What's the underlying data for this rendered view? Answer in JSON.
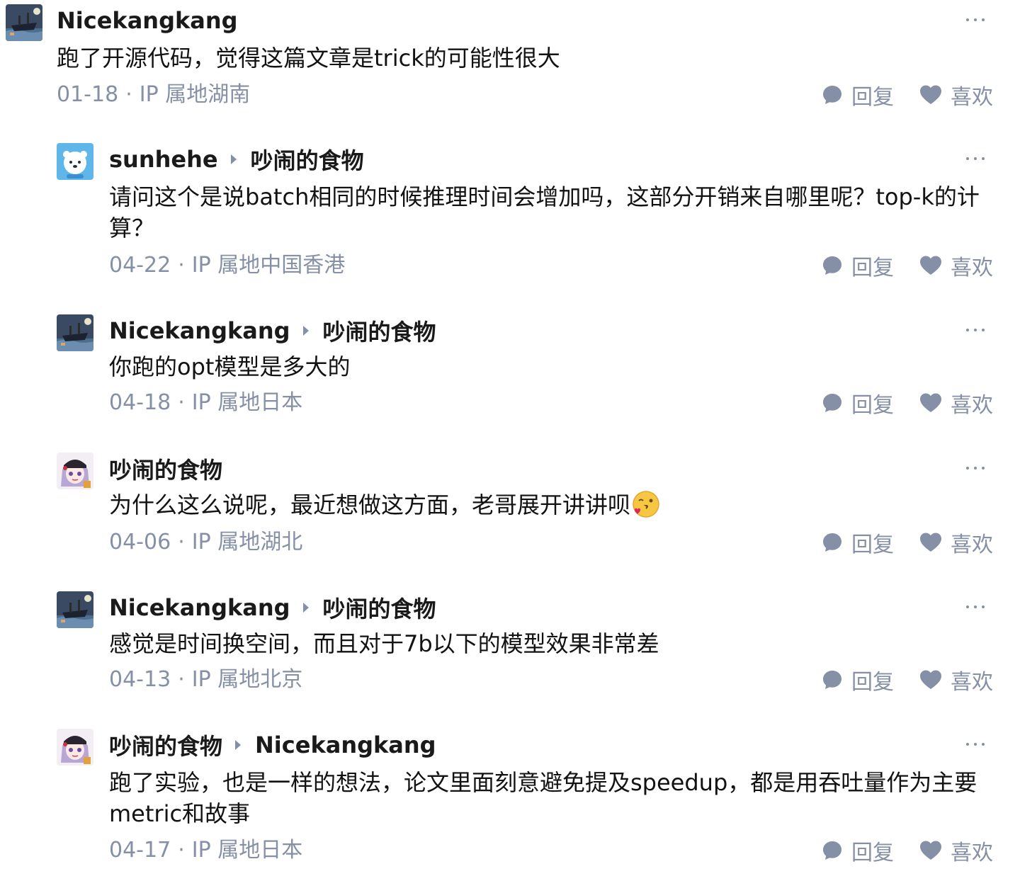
{
  "comments": [
    {
      "author": "Nicekangkang",
      "reply_to": "",
      "text": "跑了开源代码，觉得这篇文章是trick的可能性很大",
      "date": "01-18",
      "location": "IP 属地湖南"
    },
    {
      "author": "sunhehe",
      "reply_to": "吵闹的食物",
      "text": "请问这个是说batch相同的时候推理时间会增加吗，这部分开销来自哪里呢？top-k的计算？",
      "date": "04-22",
      "location": "IP 属地中国香港"
    },
    {
      "author": "Nicekangkang",
      "reply_to": "吵闹的食物",
      "text": "你跑的opt模型是多大的",
      "date": "04-18",
      "location": "IP 属地日本"
    },
    {
      "author": "吵闹的食物",
      "reply_to": "",
      "text": "为什么这么说呢，最近想做这方面，老哥展开讲讲呗",
      "date": "04-06",
      "location": "IP 属地湖北"
    },
    {
      "author": "Nicekangkang",
      "reply_to": "吵闹的食物",
      "text": "感觉是时间换空间，而且对于7b以下的模型效果非常差",
      "date": "04-13",
      "location": "IP 属地北京"
    },
    {
      "author": "吵闹的食物",
      "reply_to": "Nicekangkang",
      "text": "跑了实验，也是一样的想法，论文里面刻意避免提及speedup，都是用吞吐量作为主要metric和故事",
      "date": "04-17",
      "location": "IP 属地日本"
    }
  ],
  "actions": {
    "reply_label": "回复",
    "like_label": "喜欢"
  },
  "meta_separator": "·",
  "icons": {
    "more": "more-dots-icon",
    "reply": "comment-bubble-icon",
    "like": "heart-icon",
    "reply_arrow": "reply-arrow-icon",
    "emoji": "kiss-wink-emoji"
  },
  "colors": {
    "name": "#1a1a1a",
    "text": "#121212",
    "meta": "#8590a6",
    "icon": "#8590a6"
  }
}
